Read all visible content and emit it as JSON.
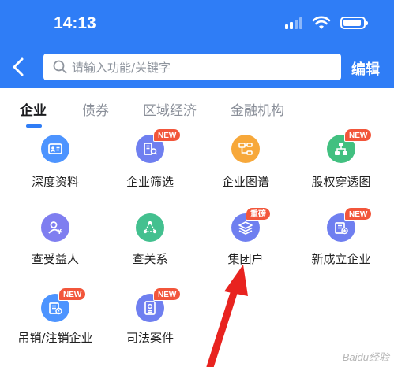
{
  "status_bar": {
    "time": "14:13"
  },
  "nav": {
    "search_placeholder": "请输入功能/关键字",
    "edit_label": "编辑"
  },
  "tabs": [
    {
      "label": "企业",
      "active": true
    },
    {
      "label": "债券",
      "active": false
    },
    {
      "label": "区域经济",
      "active": false
    },
    {
      "label": "金融机构",
      "active": false
    }
  ],
  "grid": {
    "items": [
      {
        "label": "深度资料",
        "icon": "profile-card-icon",
        "color": "#4d94ff"
      },
      {
        "label": "企业筛选",
        "icon": "building-filter-icon",
        "color": "#6f7ff0",
        "badge": "NEW"
      },
      {
        "label": "企业图谱",
        "icon": "graph-map-icon",
        "color": "#f7a83a"
      },
      {
        "label": "股权穿透图",
        "icon": "equity-tree-icon",
        "color": "#42c080",
        "badge": "NEW"
      },
      {
        "label": "查受益人",
        "icon": "beneficiary-icon",
        "color": "#7f7ef0"
      },
      {
        "label": "查关系",
        "icon": "relationship-icon",
        "color": "#43c08f"
      },
      {
        "label": "集团户",
        "icon": "group-layers-icon",
        "color": "#6f7ff0",
        "badge": "重磅"
      },
      {
        "label": "新成立企业",
        "icon": "new-company-icon",
        "color": "#6f7ff0",
        "badge": "NEW"
      },
      {
        "label": "吊销/注销企业",
        "icon": "revoked-company-icon",
        "color": "#4d94ff",
        "badge": "NEW"
      },
      {
        "label": "司法案件",
        "icon": "legal-case-icon",
        "color": "#6f7ff0",
        "badge": "NEW"
      }
    ]
  },
  "watermark": "Baidu经验"
}
